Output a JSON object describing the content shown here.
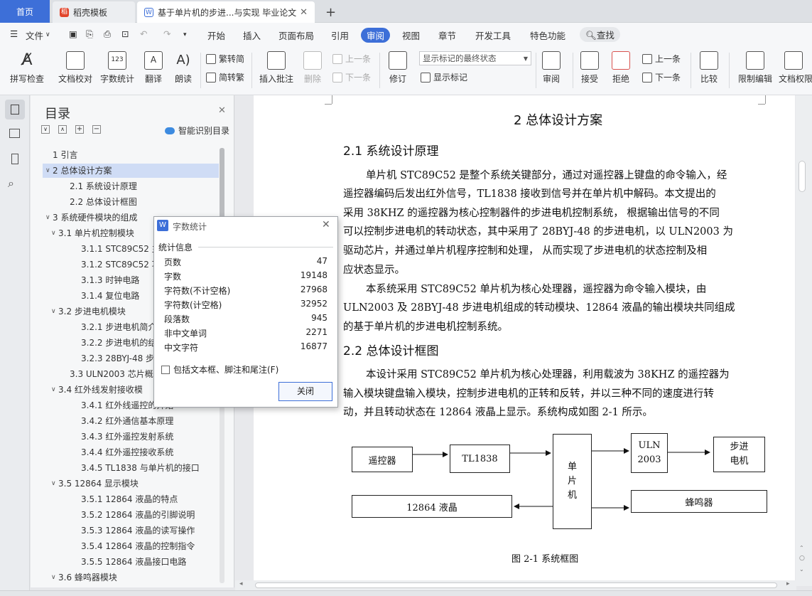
{
  "tabs": {
    "home": "首页",
    "daoke": "稻壳模板",
    "doc": "基于单片机的步进...与实现 毕业论文",
    "new_tab": "+"
  },
  "menus": {
    "file": "文件",
    "start": "开始",
    "insert": "插入",
    "layout": "页面布局",
    "reference": "引用",
    "review": "审阅",
    "view": "视图",
    "chapter": "章节",
    "devtools": "开发工具",
    "features": "特色功能",
    "search": "查找"
  },
  "ribbon": {
    "spell": "拼写检查",
    "proof": "文档校对",
    "wordcount": "字数统计",
    "translate": "翻译",
    "read": "朗读",
    "to_trad": "繁转简",
    "to_simp": "简转繁",
    "insert_comment": "插入批注",
    "delete": "删除",
    "prev": "上一条",
    "next": "下一条",
    "revise": "修订",
    "markup_select": "显示标记的最终状态",
    "show_markup": "显示标记",
    "review": "审阅",
    "accept": "接受",
    "reject": "拒绝",
    "prev2": "上一条",
    "next2": "下一条",
    "compare": "比较",
    "restrict": "限制编辑",
    "doc_rights": "文档权限"
  },
  "toc": {
    "title": "目录",
    "smart": "智能识别目录",
    "items": [
      "1  引言",
      "2  总体设计方案",
      "2.1  系统设计原理",
      "2.2  总体设计框图",
      "3 系统硬件模块的组成",
      "3.1 单片机控制模块",
      "3.1.1 STC89C52 主",
      "3.1.2 STC89C52 功",
      "3.1.3  时钟电路",
      "3.1.4 复位电路",
      "3.2  步进电机模块",
      "3.2.1  步进电机简介",
      "3.2.2 步进电机的结",
      "3.2.3 28BYJ-48 步进",
      "3.3 ULN2003 芯片概述",
      "3.4  红外线发射接收模",
      "3.4.1  红外线遥控的开始",
      "3.4.2 红外通信基本原理",
      "3.4.3  红外遥控发射系统",
      "3.4.4  红外遥控接收系统",
      "3.4.5 TL1838 与单片机的接口",
      "3.5 12864 显示模块",
      "3.5.1 12864 液晶的特点",
      "3.5.2 12864 液晶的引脚说明",
      "3.5.3 12864 液晶的读写操作",
      "3.5.4 12864 液晶的控制指令",
      "3.5.5 12864 液晶接口电路",
      "3.6  蜂鸣器模块"
    ]
  },
  "dialog": {
    "title": "字数统计",
    "section": "统计信息",
    "rows": [
      {
        "label": "页数",
        "value": "47"
      },
      {
        "label": "字数",
        "value": "19148"
      },
      {
        "label": "字符数(不计空格)",
        "value": "27968"
      },
      {
        "label": "字符数(计空格)",
        "value": "32952"
      },
      {
        "label": "段落数",
        "value": "945"
      },
      {
        "label": "非中文单词",
        "value": "2271"
      },
      {
        "label": "中文字符",
        "value": "16877"
      }
    ],
    "checkbox": "包括文本框、脚注和尾注(F)",
    "close": "关闭"
  },
  "doc": {
    "h1": "2  总体设计方案",
    "h2a": "2.1  系统设计原理",
    "p1": [
      "单片机 STC89C52 是整个系统关键部分，通过对遥控器上键盘的命令输入，经",
      "遥控器编码后发出红外信号，TL1838 接收到信号并在单片机中解码。本文提出的",
      "采用 38KHZ 的遥控器为核心控制器件的步进电机控制系统， 根据输出信号的不同",
      "可以控制步进电机的转动状态，其中采用了 28BYJ-48 的步进电机，以 ULN2003 为",
      "驱动芯片，并通过单片机程序控制和处理，  从而实现了步进电机的状态控制及相",
      "应状态显示。"
    ],
    "p2": [
      "本系统采用 STC89C52 单片机为核心处理器，遥控器为命令输入模块，由",
      "ULN2003 及 28BYJ-48 步进电机组成的转动模块、12864 液晶的输出模块共同组成",
      "的基于单片机的步进电机控制系统。"
    ],
    "h2b": "2.2  总体设计框图",
    "p3": [
      "本设计采用 STC89C52 单片机为核心处理器，利用载波为 38KHZ 的遥控器为",
      "输入模块键盘输入模块，控制步进电机的正转和反转，并以三种不同的速度进行转",
      "动，并且转动状态在 12864 液晶上显示。系统构成如图 2-1 所示。"
    ],
    "diagram": {
      "remote": "遥控器",
      "tl1838": "TL1838",
      "mcu": "单\n片\n机",
      "uln": "ULN\n2003",
      "motor": "步进\n电机",
      "lcd": "12864 液晶",
      "buzzer": "蜂鸣器"
    },
    "caption": "图 2-1  系统框图"
  }
}
